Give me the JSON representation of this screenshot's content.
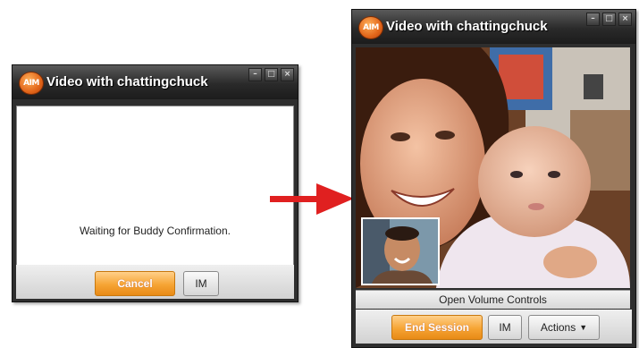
{
  "left_window": {
    "logo_text": "AIM",
    "title": "Video with chattingchuck",
    "status_text": "Waiting for Buddy Confirmation.",
    "cancel_label": "Cancel",
    "im_label": "IM"
  },
  "right_window": {
    "logo_text": "AIM",
    "title": "Video with chattingchuck",
    "volume_controls_label": "Open Volume Controls",
    "end_session_label": "End Session",
    "im_label": "IM",
    "actions_label": "Actions"
  },
  "icons": [
    "aim-logo-icon",
    "minimize-icon",
    "maximize-icon",
    "close-icon",
    "chevron-down-icon",
    "arrow-right-icon"
  ],
  "colors": {
    "titlebar": "#2a2a2a",
    "accent": "#f6a434",
    "arrow": "#e02020"
  }
}
